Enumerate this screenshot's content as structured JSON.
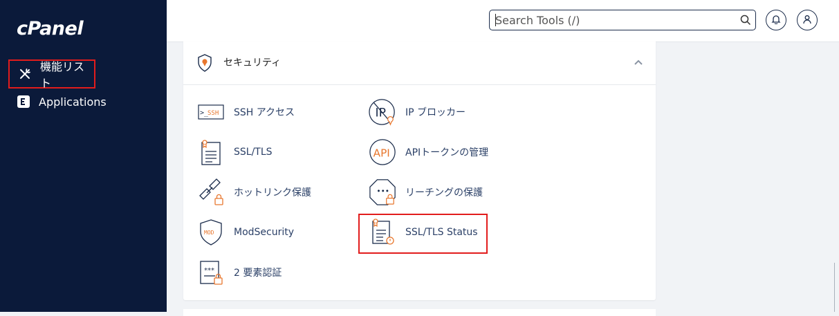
{
  "app": {
    "logo_text": "cPanel"
  },
  "sidebar": {
    "items": [
      {
        "label": "機能リスト",
        "icon": "tools-icon",
        "active": true
      },
      {
        "label": "Applications",
        "icon": "applications-icon",
        "active": false
      }
    ]
  },
  "header": {
    "search_placeholder": "Search Tools (/)",
    "notifications_icon": "bell-icon",
    "user_icon": "user-icon"
  },
  "section": {
    "title": "セキュリティ",
    "icon": "shield-icon",
    "collapse_icon": "chevron-up-icon",
    "tools": [
      {
        "label": "SSH アクセス",
        "icon": "ssh-icon"
      },
      {
        "label": "IP ブロッカー",
        "icon": "ip-blocker-icon"
      },
      {
        "label": "SSL/TLS",
        "icon": "ssl-certificate-icon"
      },
      {
        "label": "APIトークンの管理",
        "icon": "api-icon"
      },
      {
        "label": "ホットリンク保護",
        "icon": "hotlink-icon"
      },
      {
        "label": "リーチングの保護",
        "icon": "leech-protect-icon"
      },
      {
        "label": "ModSecurity",
        "icon": "modsecurity-icon"
      },
      {
        "label": "SSL/TLS Status",
        "icon": "ssl-status-icon"
      },
      {
        "label": "2 要素認証",
        "icon": "two-factor-icon"
      }
    ]
  },
  "colors": {
    "sidebar_bg": "#0b1a3a",
    "link_text": "#2a3f66",
    "accent_orange": "#e8772e",
    "highlight_red": "#e21c1c"
  }
}
